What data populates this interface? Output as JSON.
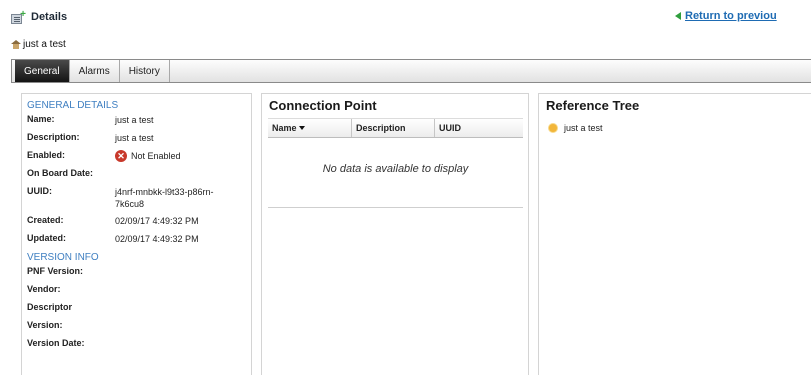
{
  "header": {
    "title": "Details",
    "return_label": "Return to previou"
  },
  "breadcrumb": {
    "label": "just a test"
  },
  "tabs": [
    {
      "label": "General",
      "active": true
    },
    {
      "label": "Alarms",
      "active": false
    },
    {
      "label": "History",
      "active": false
    }
  ],
  "general": {
    "section_title": "GENERAL DETAILS",
    "name_label": "Name:",
    "name_value": "just a test",
    "description_label": "Description:",
    "description_value": "just a test",
    "enabled_label": "Enabled:",
    "enabled_value": "Not Enabled",
    "onboard_label": "On Board Date:",
    "onboard_value": "",
    "uuid_label": "UUID:",
    "uuid_value": "j4nrf-mnbkk-l9t33-p86rn-7k6cu8",
    "created_label": "Created:",
    "created_value": "02/09/17 4:49:32 PM",
    "updated_label": "Updated:",
    "updated_value": "02/09/17 4:49:32 PM"
  },
  "version": {
    "section_title": "VERSION INFO",
    "pnf_version_label": "PNF Version:",
    "vendor_label": "Vendor:",
    "descriptor_label": "Descriptor",
    "version_label": "Version:",
    "version_date_label": "Version Date:"
  },
  "connection_point": {
    "title": "Connection Point",
    "columns": [
      "Name",
      "Description",
      "UUID"
    ],
    "empty_message": "No data is available to display"
  },
  "reference_tree": {
    "title": "Reference Tree",
    "items": [
      {
        "label": "just a test"
      }
    ]
  },
  "colors": {
    "section_heading": "#3f7fc1",
    "link": "#1e6bb3",
    "error": "#c8392b"
  }
}
